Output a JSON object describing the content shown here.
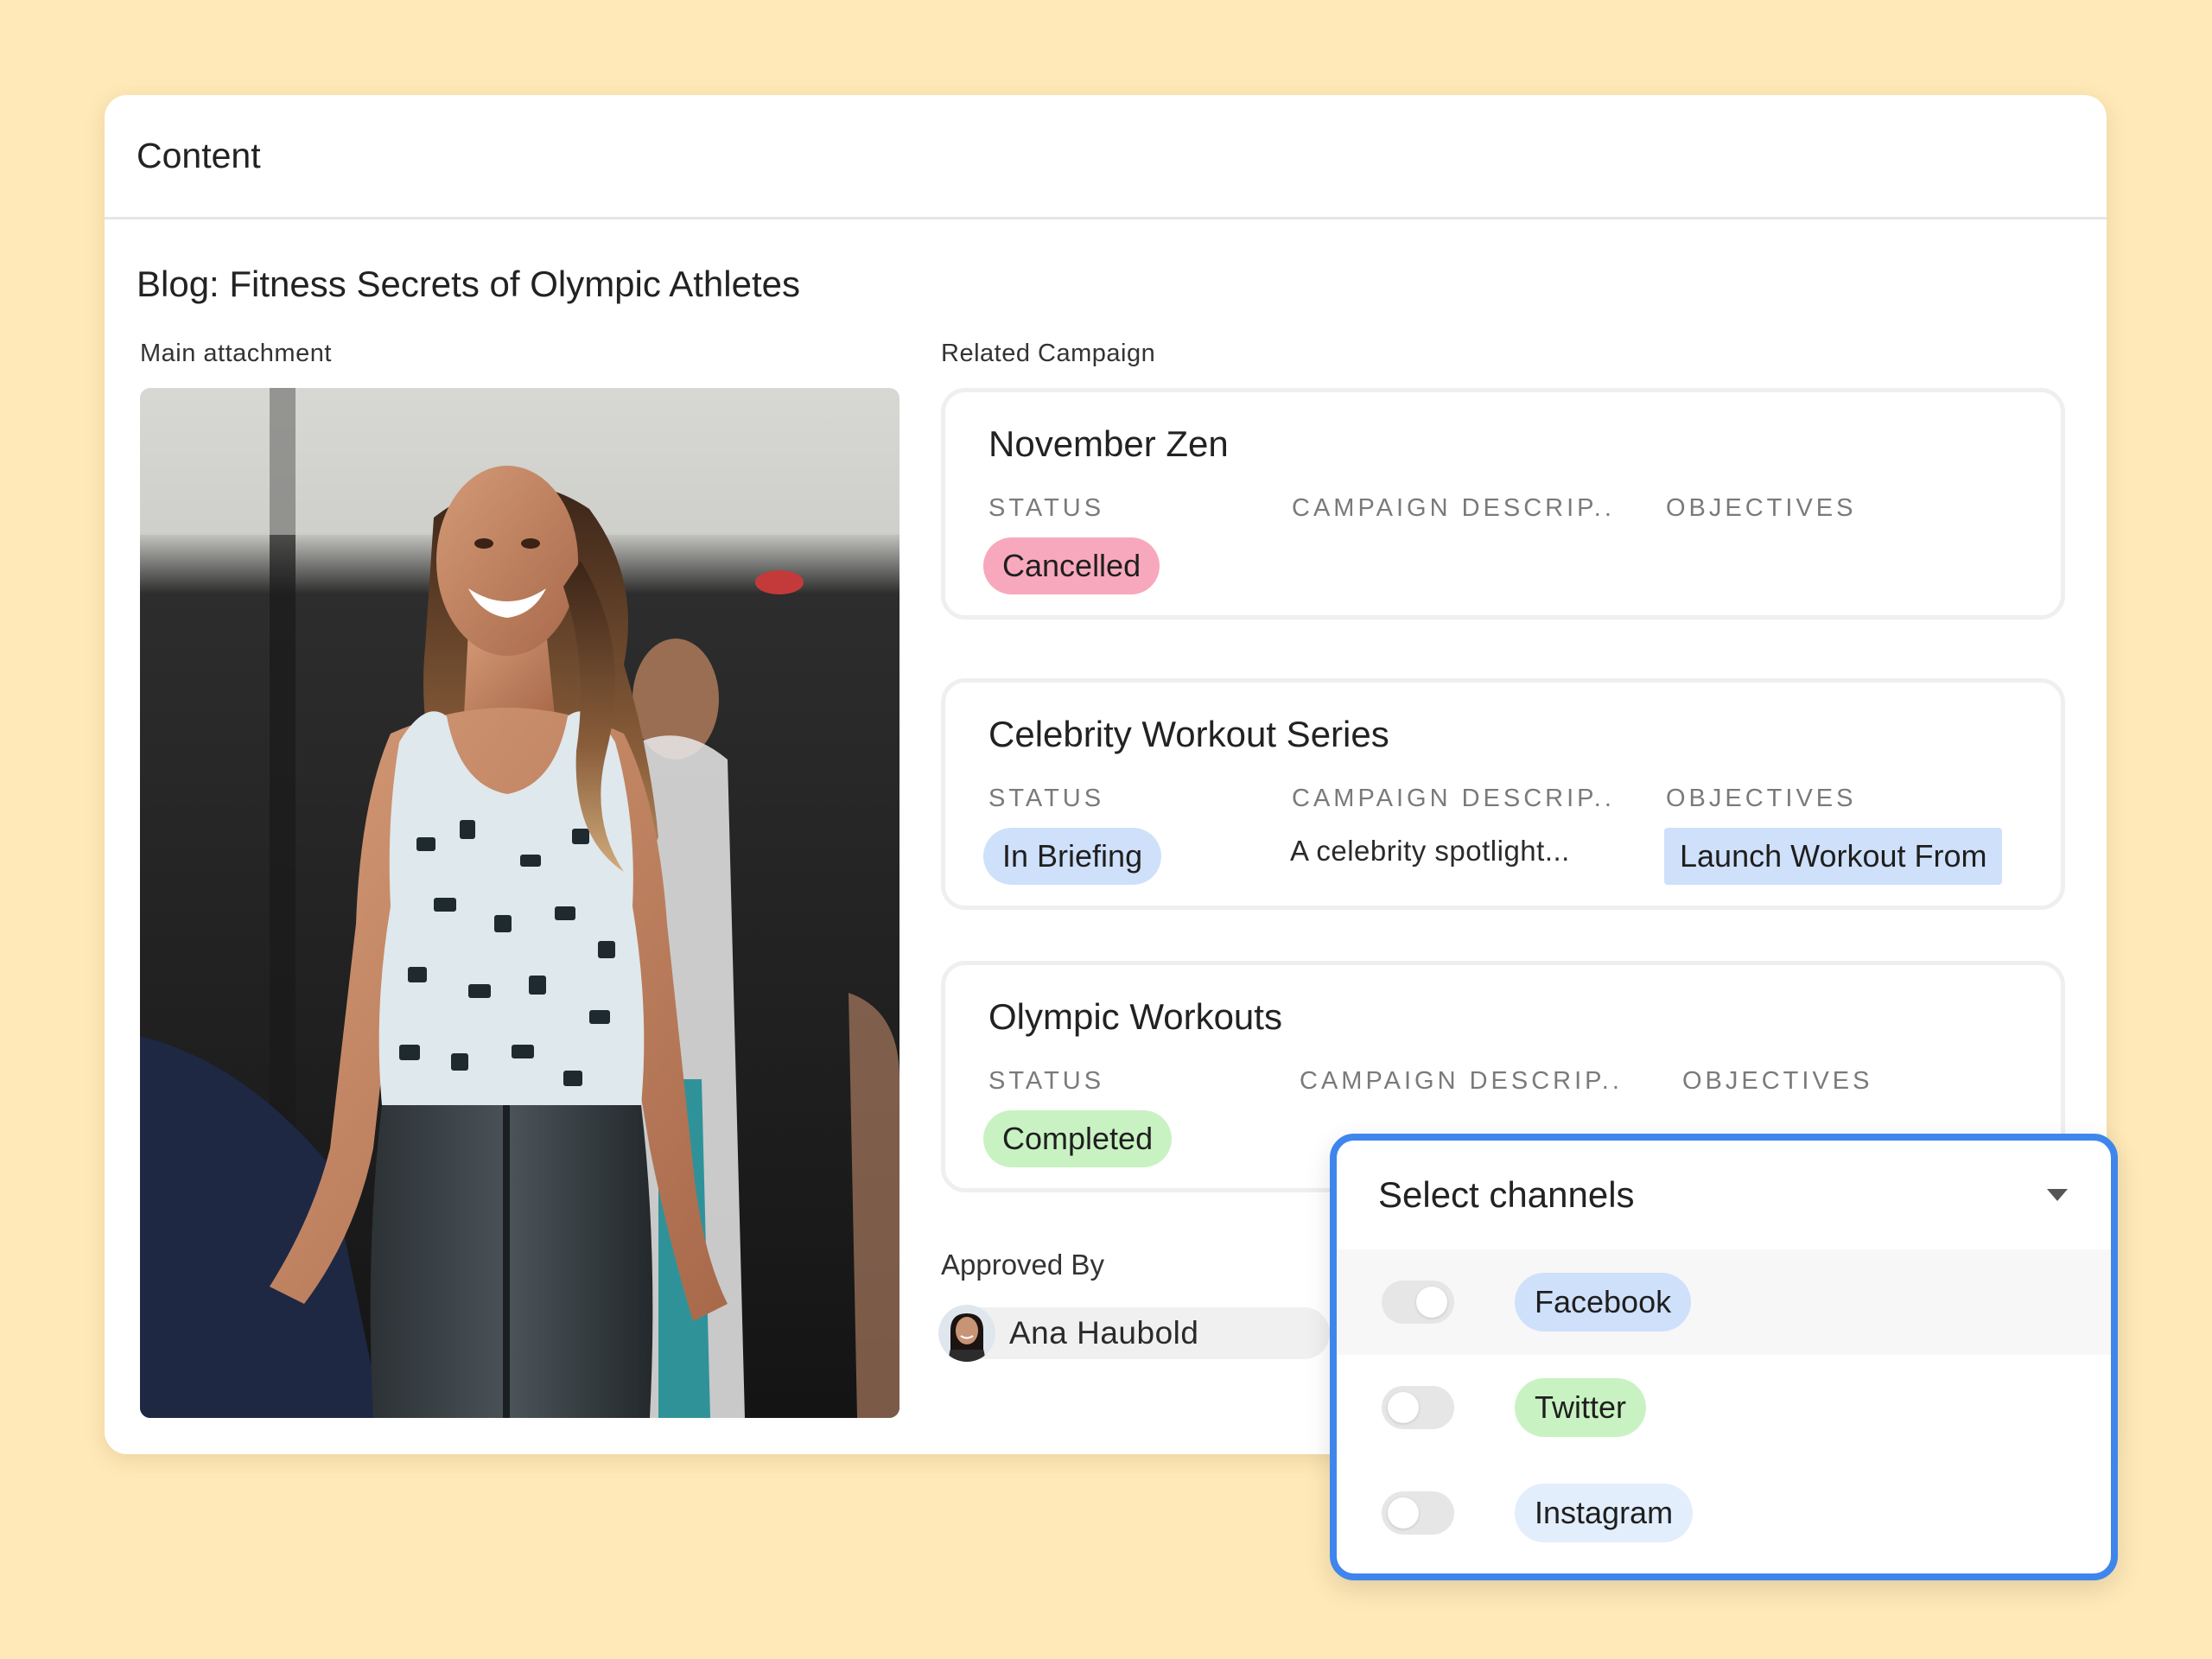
{
  "header": {
    "title": "Content"
  },
  "record": {
    "title": "Blog: Fitness Secrets of Olympic Athletes"
  },
  "labels": {
    "main_attachment": "Main attachment",
    "related_campaign": "Related Campaign",
    "approved_by": "Approved By"
  },
  "columns": {
    "status": "STATUS",
    "description": "CAMPAIGN DESCRIP..",
    "objectives": "OBJECTIVES"
  },
  "campaigns": [
    {
      "name": "November Zen",
      "status": "Cancelled",
      "status_color": "#f8a8bd",
      "description": "",
      "objective": ""
    },
    {
      "name": "Celebrity Workout Series",
      "status": "In Briefing",
      "status_color": "#cfe0fb",
      "description": "A celebrity spotlight...",
      "objective": "Launch Workout From"
    },
    {
      "name": "Olympic Workouts",
      "status": "Completed",
      "status_color": "#c9f2c2",
      "description": "",
      "objective": ""
    }
  ],
  "approver": {
    "name": "Ana Haubold"
  },
  "channels": {
    "title": "Select channels",
    "options": [
      {
        "label": "Facebook",
        "color": "#cfe0fb",
        "enabled": false,
        "highlighted": true
      },
      {
        "label": "Twitter",
        "color": "#c9f2c2",
        "enabled": false,
        "highlighted": false
      },
      {
        "label": "Instagram",
        "color": "#e3eefc",
        "enabled": false,
        "highlighted": false
      }
    ]
  },
  "colors": {
    "background": "#ffe9b8",
    "accent": "#3f86ec"
  }
}
